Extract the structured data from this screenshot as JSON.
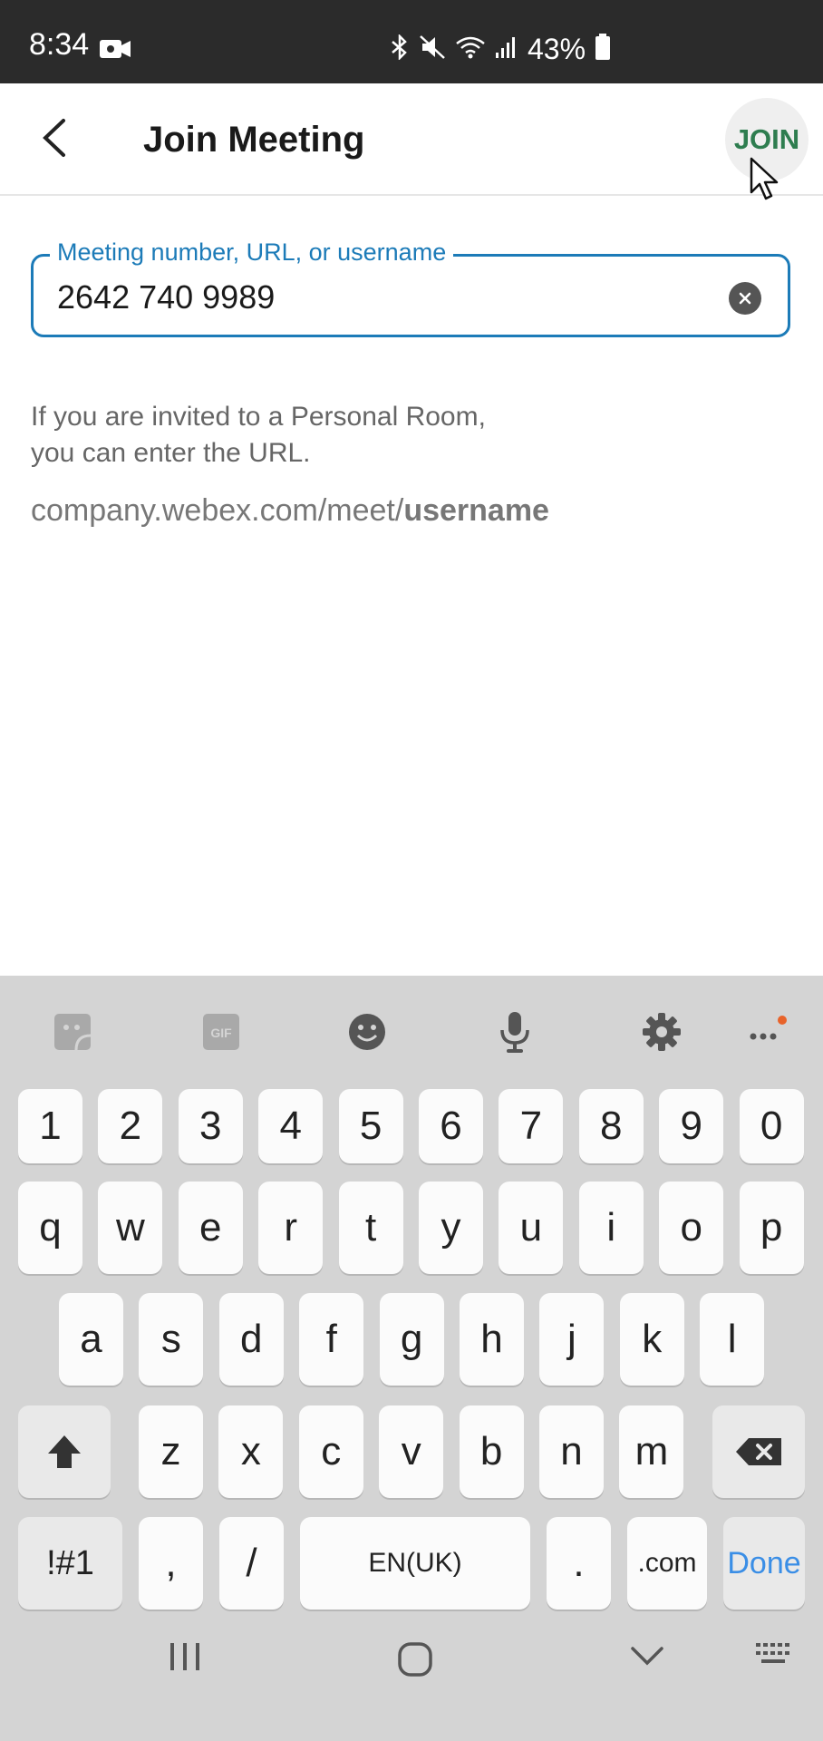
{
  "status_bar": {
    "time": "8:34",
    "battery": "43%"
  },
  "header": {
    "title": "Join Meeting",
    "join_label": "JOIN"
  },
  "input": {
    "label": "Meeting number, URL, or username",
    "value": "2642 740 9989"
  },
  "hint": {
    "line1": "If you are invited to a Personal Room,",
    "line2": "you can enter the URL.",
    "example_prefix": "company.webex.com/meet/",
    "example_bold": "username"
  },
  "keyboard": {
    "toolbar_icons": [
      "sticker-icon",
      "gif-icon",
      "emoji-icon",
      "microphone-icon",
      "settings-gear-icon",
      "more-options-icon"
    ],
    "gif_label": "GIF",
    "row1": [
      "1",
      "2",
      "3",
      "4",
      "5",
      "6",
      "7",
      "8",
      "9",
      "0"
    ],
    "row2": [
      "q",
      "w",
      "e",
      "r",
      "t",
      "y",
      "u",
      "i",
      "o",
      "p"
    ],
    "row3": [
      "a",
      "s",
      "d",
      "f",
      "g",
      "h",
      "j",
      "k",
      "l"
    ],
    "row4": [
      "z",
      "x",
      "c",
      "v",
      "b",
      "n",
      "m"
    ],
    "symbols_label": "!#1",
    "comma": ",",
    "slash": "/",
    "space_label": "EN(UK)",
    "period": ".",
    "dotcom": ".com",
    "done_label": "Done",
    "accent_color": "#3a8ee6"
  },
  "colors": {
    "join": "#2e7d4f",
    "field_border": "#1c7bb8",
    "status_bar": "#2b2b2b"
  }
}
